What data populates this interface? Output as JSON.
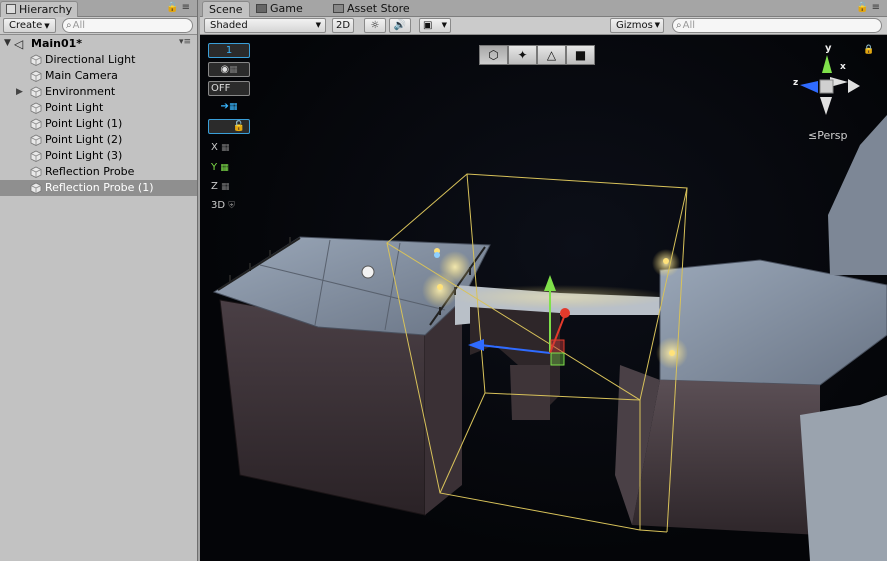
{
  "hierarchy": {
    "tab_title": "Hierarchy",
    "create_label": "Create",
    "search_placeholder": "All",
    "scene_name": "Main01*",
    "items": [
      {
        "label": "Directional Light"
      },
      {
        "label": "Main Camera"
      },
      {
        "label": "Environment",
        "expandable": true
      },
      {
        "label": "Point Light"
      },
      {
        "label": "Point Light (1)"
      },
      {
        "label": "Point Light (2)"
      },
      {
        "label": "Point Light (3)"
      },
      {
        "label": "Reflection Probe"
      },
      {
        "label": "Reflection Probe (1)",
        "selected": true
      }
    ]
  },
  "scene_panel": {
    "tabs": [
      {
        "label": "Scene",
        "active": true,
        "icon": "scene-icon"
      },
      {
        "label": "Game",
        "icon": "game-icon"
      },
      {
        "label": "Asset Store",
        "icon": "asset-store-icon"
      }
    ],
    "shading_mode": "Shaded",
    "toggle_2d": "2D",
    "gizmos_label": "Gizmos",
    "search_placeholder": "All",
    "persp_label": "Persp",
    "overlay_tools": {
      "number_value": "1",
      "off_label": "OFF",
      "x_label": "X",
      "y_label": "Y",
      "z_label": "Z",
      "threed_label": "3D"
    },
    "view_modes": [
      "cube-icon",
      "vertex-icon",
      "edge-icon",
      "face-icon"
    ],
    "gizmo_axis_labels": {
      "x": "x",
      "y": "y",
      "z": "z"
    },
    "colors": {
      "selection_box": "#d8c25a",
      "axis_x": "#e33a2b",
      "axis_y": "#7fe04a",
      "axis_z": "#2f6bff",
      "accent_blue": "#3ab7ff",
      "selected_row": "#8f8f8f"
    }
  }
}
